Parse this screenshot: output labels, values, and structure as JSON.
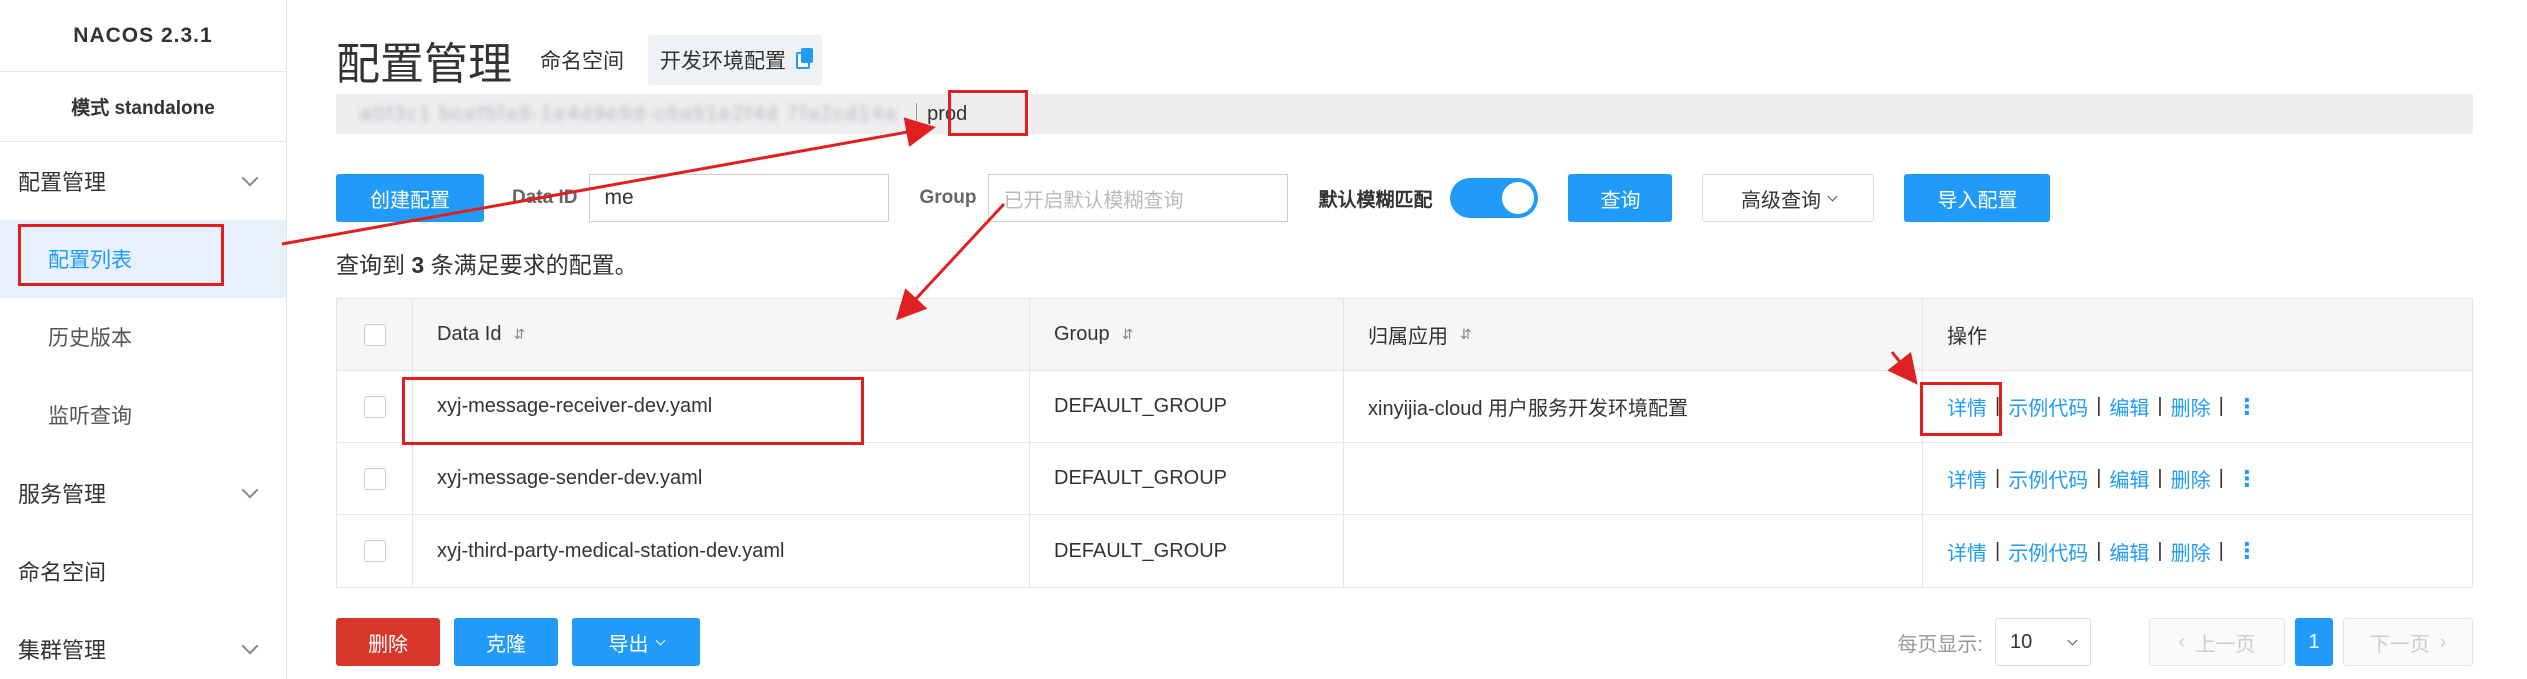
{
  "app": {
    "brand": "NACOS 2.3.1",
    "mode": "模式 standalone"
  },
  "sidebar": {
    "groups": [
      {
        "label": "配置管理",
        "items": [
          "配置列表",
          "历史版本",
          "监听查询"
        ]
      },
      {
        "label": "服务管理"
      },
      {
        "label": "命名空间"
      },
      {
        "label": "集群管理"
      }
    ]
  },
  "header": {
    "title": "配置管理",
    "namespace_label": "命名空间",
    "namespace_value": "开发环境配置",
    "namespace_id_blurred": "a0f3c1 bcef5fa9-1e4d9e9d-c0a91e2f4d 7fa2cd14a",
    "namespace_prod": "prod"
  },
  "search": {
    "create_label": "创建配置",
    "dataid_label": "Data ID",
    "dataid_value": "me",
    "group_label": "Group",
    "group_placeholder": "已开启默认模糊查询",
    "fuzzy_label": "默认模糊匹配",
    "query_label": "查询",
    "advanced_label": "高级查询",
    "import_label": "导入配置"
  },
  "result": {
    "prefix": "查询到",
    "count": "3",
    "suffix": "条满足要求的配置。"
  },
  "table": {
    "headers": {
      "dataid": "Data Id",
      "group": "Group",
      "app": "归属应用",
      "ops": "操作"
    },
    "sort_icon": "⇵",
    "ops": {
      "detail": "详情",
      "sample": "示例代码",
      "edit": "编辑",
      "delete": "删除",
      "sep": "|",
      "more": "⋮"
    },
    "rows": [
      {
        "dataid": "xyj-message-receiver-dev.yaml",
        "group": "DEFAULT_GROUP",
        "app": "xinyijia-cloud 用户服务开发环境配置"
      },
      {
        "dataid": "xyj-message-sender-dev.yaml",
        "group": "DEFAULT_GROUP",
        "app": ""
      },
      {
        "dataid": "xyj-third-party-medical-station-dev.yaml",
        "group": "DEFAULT_GROUP",
        "app": ""
      }
    ]
  },
  "footer": {
    "delete_label": "删除",
    "clone_label": "克隆",
    "export_label": "导出",
    "page_size_label": "每页显示:",
    "page_size": "10",
    "prev_label": "上一页",
    "page": "1",
    "next_label": "下一页"
  },
  "colors": {
    "accent": "#209bfa",
    "danger": "#d9362b",
    "annotation": "#e02020"
  }
}
